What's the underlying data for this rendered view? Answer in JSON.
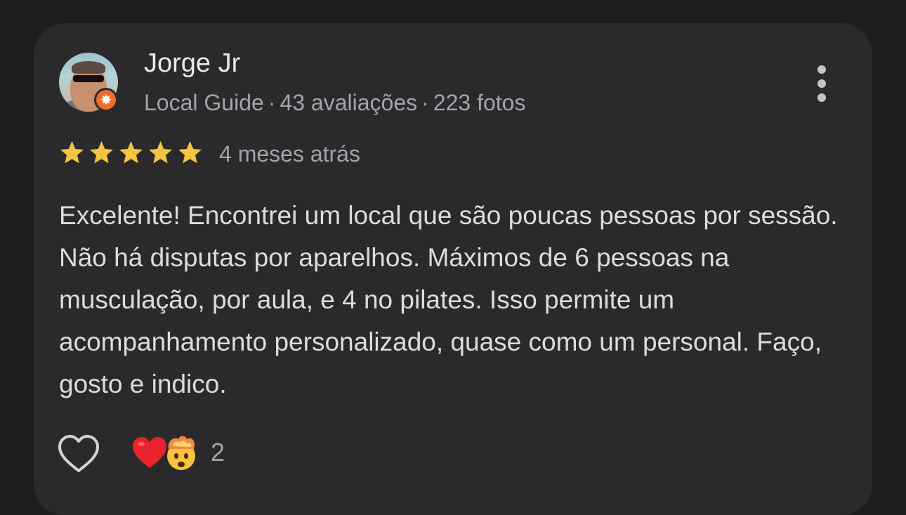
{
  "review": {
    "author_name": "Jorge Jr",
    "author_meta": {
      "guide_label": "Local Guide",
      "reviews_count": "43 avaliações",
      "photos_count": "223 fotos",
      "separator": "·"
    },
    "rating": 5,
    "rating_max": 5,
    "time_ago": "4 meses atrás",
    "text": "Excelente! Encontrei um local que são poucas pessoas por sessão. Não há disputas por aparelhos. Máximos de 6 pessoas na musculação, por aula, e 4 no pilates. Isso permite um acompanhamento personalizado, quase como um personal. Faço, gosto e indico.",
    "reaction_icons": [
      "red-heart-icon",
      "exploding-head-icon"
    ],
    "reaction_count": "2"
  },
  "colors": {
    "background": "#1e1e20",
    "card": "#2a2a2d",
    "star": "#f5c542",
    "guide_badge": "#f06b2a",
    "heart": "#e8232c"
  }
}
